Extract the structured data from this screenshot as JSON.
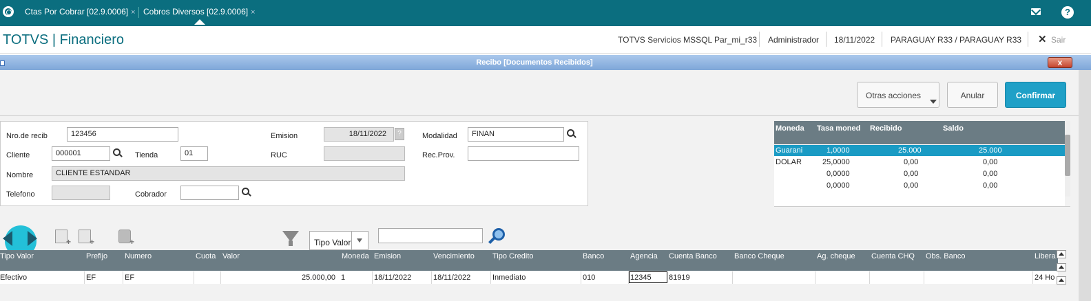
{
  "topbar": {
    "tabs": [
      {
        "label": "Ctas Por Cobrar [02.9.0006]"
      },
      {
        "label": "Cobros Diversos [02.9.0006]"
      }
    ],
    "close_glyph": "×"
  },
  "header": {
    "title": "TOTVS | Financiero",
    "server": "TOTVS Servicios MSSQL Par_mi_r33",
    "user": "Administrador",
    "date": "18/11/2022",
    "company": "PARAGUAY R33 / PARAGUAY R33",
    "exit_label": "Sair"
  },
  "dialog": {
    "title": "Recibo [Documentos Recibidos]",
    "close_label": "x",
    "buttons": {
      "otras": "Otras acciones",
      "anular": "Anular",
      "confirmar": "Confirmar"
    }
  },
  "form": {
    "nro_label": "Nro.de recib",
    "nro_value": "123456",
    "emision_label": "Emision",
    "emision_value": "18/11/2022",
    "modalidad_label": "Modalidad",
    "modalidad_value": "FINAN",
    "cliente_label": "Cliente",
    "cliente_value": "000001",
    "tienda_label": "Tienda",
    "tienda_value": "01",
    "ruc_label": "RUC",
    "ruc_value": "",
    "recprov_label": "Rec.Prov.",
    "recprov_value": "",
    "nombre_label": "Nombre",
    "nombre_value": "CLIENTE ESTANDAR",
    "telefono_label": "Telefono",
    "telefono_value": "",
    "cobrador_label": "Cobrador",
    "cobrador_value": ""
  },
  "currency_grid": {
    "headers": [
      "Moneda",
      "Tasa moned",
      "Recibido",
      "Saldo"
    ],
    "rows": [
      {
        "moneda": "Guarani",
        "tasa": "1,0000",
        "recibido": "25.000",
        "saldo": "25.000"
      },
      {
        "moneda": "DOLAR",
        "tasa": "25,0000",
        "recibido": "0,00",
        "saldo": "0,00"
      },
      {
        "moneda": "",
        "tasa": "0,0000",
        "recibido": "0,00",
        "saldo": "0,00"
      },
      {
        "moneda": "",
        "tasa": "0,0000",
        "recibido": "0,00",
        "saldo": "0,00"
      }
    ]
  },
  "toolbar": {
    "filter_select": "Tipo Valor",
    "search_value": ""
  },
  "grid": {
    "headers": [
      "Tipo Valor",
      "Prefijo",
      "Numero",
      "Cuota",
      "Valor",
      "Moneda",
      "Emision",
      "Vencimiento",
      "Tipo Credito",
      "Banco",
      "Agencia",
      "Cuenta Banco",
      "Banco Cheque",
      "Ag. cheque",
      "Cuenta CHQ",
      "Obs. Banco",
      "Libera"
    ],
    "row": {
      "tipo_valor": "Efectivo",
      "prefijo": "EF",
      "numero": "EF",
      "cuota": "",
      "valor": "25.000,00",
      "moneda": "1",
      "emision": "18/11/2022",
      "vencimiento": "18/11/2022",
      "tipo_credito": "Inmediato",
      "banco": "010",
      "agencia": "12345",
      "cuenta_banco": "81919",
      "banco_cheque": "",
      "ag_cheque": "",
      "cuenta_chq": "",
      "obs_banco": "",
      "libera": "24 Ho"
    }
  },
  "colors": {
    "topbar": "#0b6e7f",
    "accent": "#1fa0c7",
    "grid_header": "#6b7c84",
    "selected_row": "#1a9bc4"
  }
}
